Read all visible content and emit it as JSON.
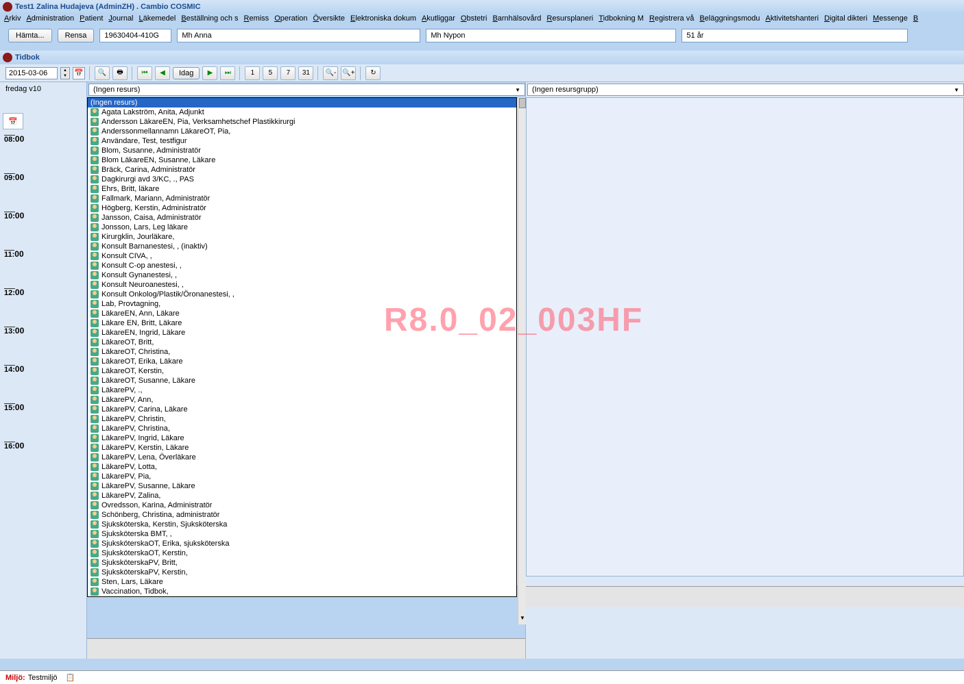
{
  "title": "Test1 Zalina Hudajeva (AdminZH) . Cambio COSMIC",
  "menu": [
    "Arkiv",
    "Administration",
    "Patient",
    "Journal",
    "Läkemedel",
    "Beställning och s",
    "Remiss",
    "Operation",
    "Översikte",
    "Elektroniska dokum",
    "Akutliggar",
    "Obstetri",
    "Barnhälsovård",
    "Resursplaneri",
    "Tidbokning M",
    "Registrera vå",
    "Beläggningsmodu",
    "Aktivitetshanteri",
    "Digital dikteri",
    "Messenge",
    "B"
  ],
  "patientBar": {
    "hamta": "Hämta...",
    "rensa": "Rensa",
    "pid": "19630404-410G",
    "name1": "Mh Anna",
    "name2": "Mh Nypon",
    "age": "51 år"
  },
  "tidbok": {
    "title": "Tidbok",
    "date": "2015-03-06",
    "week": "fredag v10",
    "idag": "Idag",
    "nums": [
      "1",
      "5",
      "7",
      "31"
    ],
    "resCombo": "(Ingen resurs)",
    "groupCombo": "(Ingen resursgrupp)"
  },
  "hours": [
    "08:00",
    "09:00",
    "10:00",
    "11:00",
    "12:00",
    "13:00",
    "14:00",
    "15:00",
    "16:00"
  ],
  "dropdown": {
    "selected": "(Ingen resurs)",
    "items": [
      "Agata Lakström, Anita, Adjunkt",
      "Andersson LäkareEN, Pia, Verksamhetschef Plastikkirurgi",
      "Anderssonmellannamn LäkareOT, Pia,",
      "Användare, Test, testfigur",
      "Blom, Susanne, Administratör",
      "Blom LäkareEN, Susanne, Läkare",
      "Bräck, Carina, Administratör",
      "Dagkirurgi avd 3/KC, ., PAS",
      "Ehrs, Britt, läkare",
      "Fallmark, Mariann, Administratör",
      "Högberg, Kerstin, Administratör",
      "Jansson, Caisa, Administratör",
      "Jonsson, Lars, Leg läkare",
      "Kirurgklin, Jourläkare,",
      "Konsult Barnanestesi, , (inaktiv)",
      "Konsult CIVA, ,",
      "Konsult C-op anestesi, ,",
      "Konsult Gynanestesi, ,",
      "Konsult Neuroanestesi, ,",
      "Konsult Onkolog/Plastik/Öronanestesi, ,",
      "Lab, Provtagning,",
      "LäkareEN, Ann, Läkare",
      "Läkare EN, Britt, Läkare",
      "LäkareEN, Ingrid, Läkare",
      "LäkareOT, Britt,",
      "LäkareOT, Christina,",
      "LäkareOT, Erika, Läkare",
      "LäkareOT, Kerstin,",
      "LäkareOT, Susanne, Läkare",
      "LäkarePV, .,",
      "LäkarePV, Ann,",
      "LäkarePV, Carina, Läkare",
      "LäkarePV, Christin,",
      "LäkarePV, Christina,",
      "LäkarePV, Ingrid, Läkare",
      "LäkarePV, Kerstin, Läkare",
      "LäkarePV, Lena, Överläkare",
      "LäkarePV, Lotta,",
      "LäkarePV, Pia,",
      "LäkarePV, Susanne, Läkare",
      "LäkarePV, Zalina,",
      "Ovredsson, Karina, Administratör",
      "Schönberg, Christina, administratör",
      "Sjuksköterska, Kerstin, Sjuksköterska",
      "Sjuksköterska BMT, ,",
      "SjuksköterskaOT, Erika, sjuksköterska",
      "SjuksköterskaOT, Kerstin,",
      "SjuksköterskaPV, Britt,",
      "SjuksköterskaPV, Kerstin,",
      "Sten, Lars, Läkare",
      "Vaccination, Tidbok,"
    ]
  },
  "watermark": "R8.0_02_003HF",
  "status": {
    "label": "Miljö:",
    "value": "Testmiljö"
  }
}
